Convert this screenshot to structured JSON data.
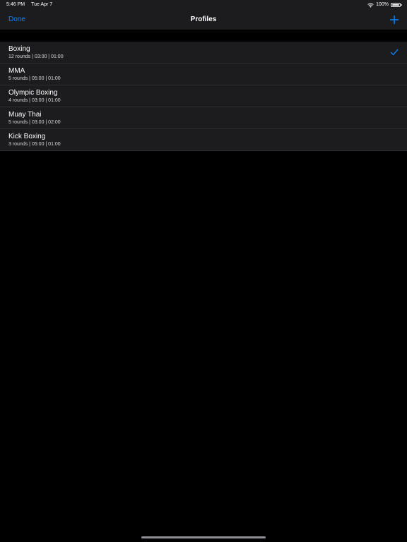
{
  "status_bar": {
    "time": "5:46 PM",
    "date": "Tue Apr 7",
    "battery_text": "100%",
    "battery_level": 1.0
  },
  "nav": {
    "done_label": "Done",
    "title": "Profiles",
    "add_icon": "plus-icon"
  },
  "profiles": [
    {
      "name": "Boxing",
      "detail": "12 rounds | 03:00 | 01:00",
      "selected": true
    },
    {
      "name": "MMA",
      "detail": "5 rounds | 05:00 | 01:00",
      "selected": false
    },
    {
      "name": "Olympic Boxing",
      "detail": "4 rounds | 03:00 | 01:00",
      "selected": false
    },
    {
      "name": "Muay Thai",
      "detail": "5 rounds | 03:00 | 02:00",
      "selected": false
    },
    {
      "name": "Kick Boxing",
      "detail": "3 rounds | 05:00 | 01:00",
      "selected": false
    }
  ],
  "colors": {
    "accent": "#0a84ff",
    "background": "#000000",
    "bar": "#1c1c1e",
    "row": "#1c1c1e"
  }
}
